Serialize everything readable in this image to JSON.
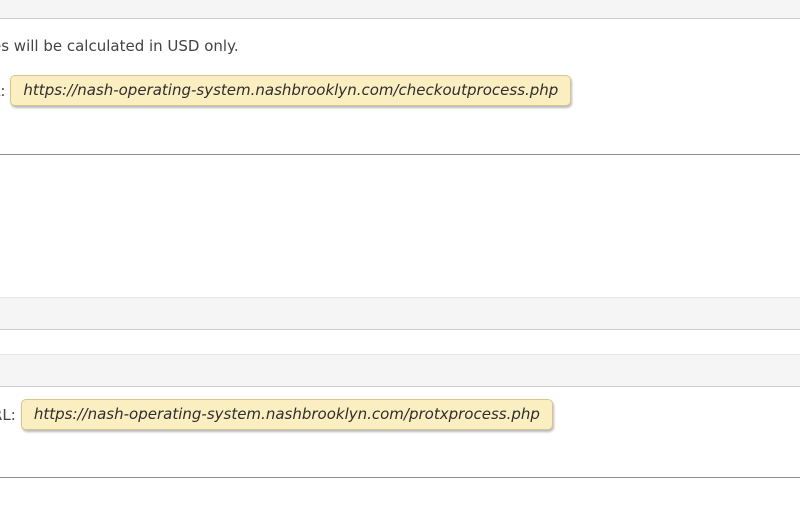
{
  "section1": {
    "note": "es will be calculated in USD only.",
    "url_label": "L:",
    "url_value": "https://nash-operating-system.nashbrooklyn.com/checkoutprocess.php"
  },
  "section2": {
    "url_label": "RL:",
    "url_value": "https://nash-operating-system.nashbrooklyn.com/protxprocess.php"
  }
}
